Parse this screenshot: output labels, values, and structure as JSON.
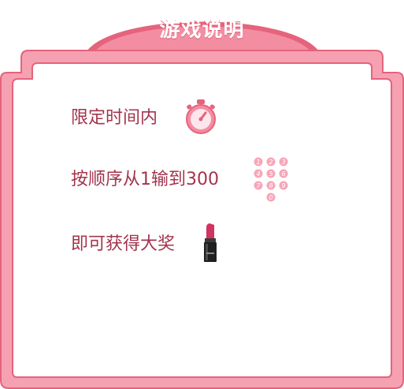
{
  "dialog": {
    "title": "游戏说明",
    "rules": [
      {
        "text": "限定时间内",
        "icon": "stopwatch-icon"
      },
      {
        "text": "按顺序从1输到300",
        "icon": "number-keypad-icon"
      },
      {
        "text": "即可获得大奖",
        "icon": "lipstick-icon"
      }
    ]
  },
  "colors": {
    "frame_outer": "#e5637c",
    "frame_fill": "#f5a1b2",
    "panel": "#ffffff",
    "text": "#a3344d",
    "key_fill": "#f7a6b8"
  }
}
